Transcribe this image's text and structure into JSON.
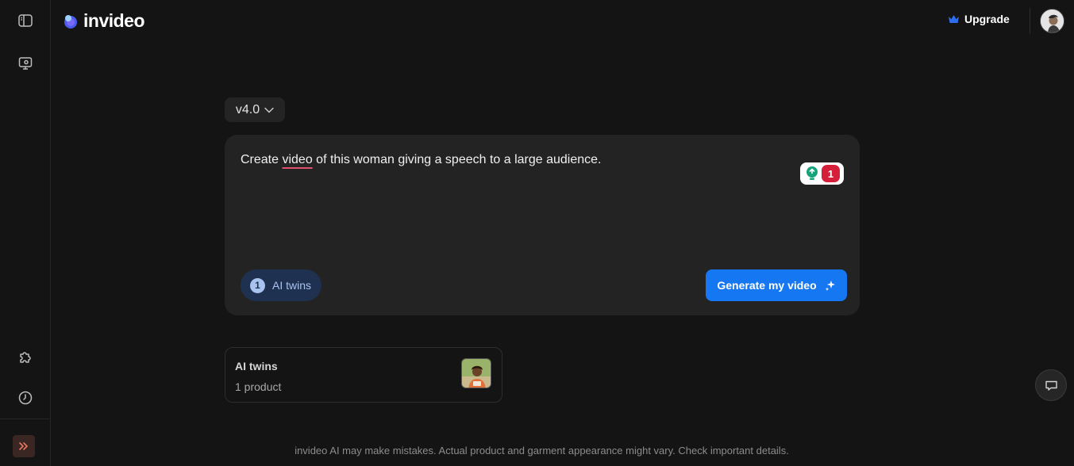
{
  "brand": {
    "name": "invideo"
  },
  "header": {
    "upgrade_label": "Upgrade"
  },
  "sidebar": {
    "icons": [
      "panel-toggle-icon",
      "project-icon",
      "puzzle-icon",
      "history-icon",
      "expand-icon"
    ]
  },
  "composer": {
    "version": "v4.0",
    "prompt_before": "Create ",
    "prompt_flagged_word": "video",
    "prompt_after": " of this woman giving a speech to a large audience.",
    "grammar_issue_count": "1",
    "attachment_count": "1",
    "attachment_label": "AI twins",
    "generate_label": "Generate my video"
  },
  "attachments_panel": {
    "title": "AI twins",
    "subtitle": "1 product"
  },
  "footer": {
    "disclaimer": "invideo AI may make mistakes. Actual product and garment appearance might vary. Check important details."
  },
  "colors": {
    "background": "#141414",
    "card": "#232323",
    "accent_blue": "#1677f2",
    "chip_bg": "#1f3150",
    "grammar_red": "#d51e3a",
    "grammar_green": "#16a37a"
  }
}
